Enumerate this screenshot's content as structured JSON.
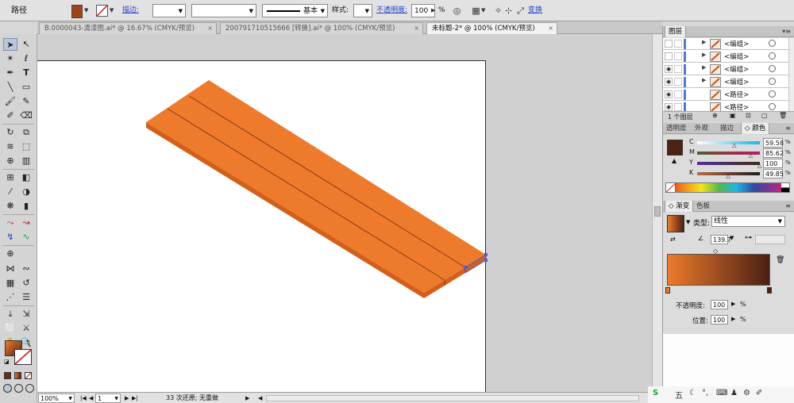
{
  "control_bar": {
    "object_type": "路径",
    "fill_color": "#a0431b",
    "stroke_label": "描边:",
    "stroke_width": "",
    "brush_definition": "",
    "profile_label": "基本",
    "style_label": "样式:",
    "opacity_label": "不透明度:",
    "opacity_value": "100",
    "opacity_unit": "%",
    "transform_label": "变换"
  },
  "tabs": [
    {
      "label": "B.0000043-清漆图.ai* @ 16.67% (CMYK/预览)",
      "close": "×"
    },
    {
      "label": "200791710515666 [转换].ai* @ 100% (CMYK/预览)",
      "close": "×"
    },
    {
      "label": "未标题-2* @ 100% (CMYK/预览)",
      "close": "×"
    }
  ],
  "canvas": {
    "plank_color": "#ee7a2c",
    "plank_side_color": "#d35f19",
    "seam_color": "#8a3b10"
  },
  "status_bar": {
    "zoom": "100%",
    "artboard": "1",
    "undo_text": "33 次还原; 无重做"
  },
  "layers_panel": {
    "title": "图层",
    "rows": [
      {
        "name": "<编组>",
        "visible": false,
        "expand": true
      },
      {
        "name": "<编组>",
        "visible": false,
        "expand": true
      },
      {
        "name": "<编组>",
        "visible": true,
        "expand": true
      },
      {
        "name": "<编组>",
        "visible": true,
        "expand": true
      },
      {
        "name": "<路径>",
        "visible": true,
        "expand": false
      },
      {
        "name": "<路径>",
        "visible": true,
        "expand": false
      }
    ],
    "footer": "1 个图层"
  },
  "color_panel": {
    "tabs": [
      "透明度",
      "外观",
      "描边",
      "颜色"
    ],
    "active_tab": "颜色",
    "current_color": "#4d2215",
    "channels": [
      {
        "label": "C",
        "value": "59.58",
        "percent": 59.58,
        "gradient": [
          "#ffffff",
          "#17b5e5"
        ]
      },
      {
        "label": "M",
        "value": "85.62",
        "percent": 85.62,
        "gradient": [
          "#5a5a2a",
          "#c01868"
        ]
      },
      {
        "label": "Y",
        "value": "100",
        "percent": 100,
        "gradient": [
          "#562f9a",
          "#3e2b1a"
        ]
      },
      {
        "label": "K",
        "value": "49.85",
        "percent": 49.85,
        "gradient": [
          "#bc6b4b",
          "#1c1c1c"
        ]
      }
    ],
    "unit": "%"
  },
  "gradient_panel": {
    "tabs": [
      "渐变",
      "色板"
    ],
    "active_tab": "渐变",
    "type_label": "类型:",
    "type_value": "线性",
    "angle": "139.7",
    "start_color": "#ee7a2c",
    "end_color": "#4a1f14",
    "opacity_label": "不透明度:",
    "opacity_value": "100",
    "location_label": "位置:",
    "location_value": "100",
    "unit": "%"
  },
  "taskbar": {
    "ime_label": "五"
  }
}
